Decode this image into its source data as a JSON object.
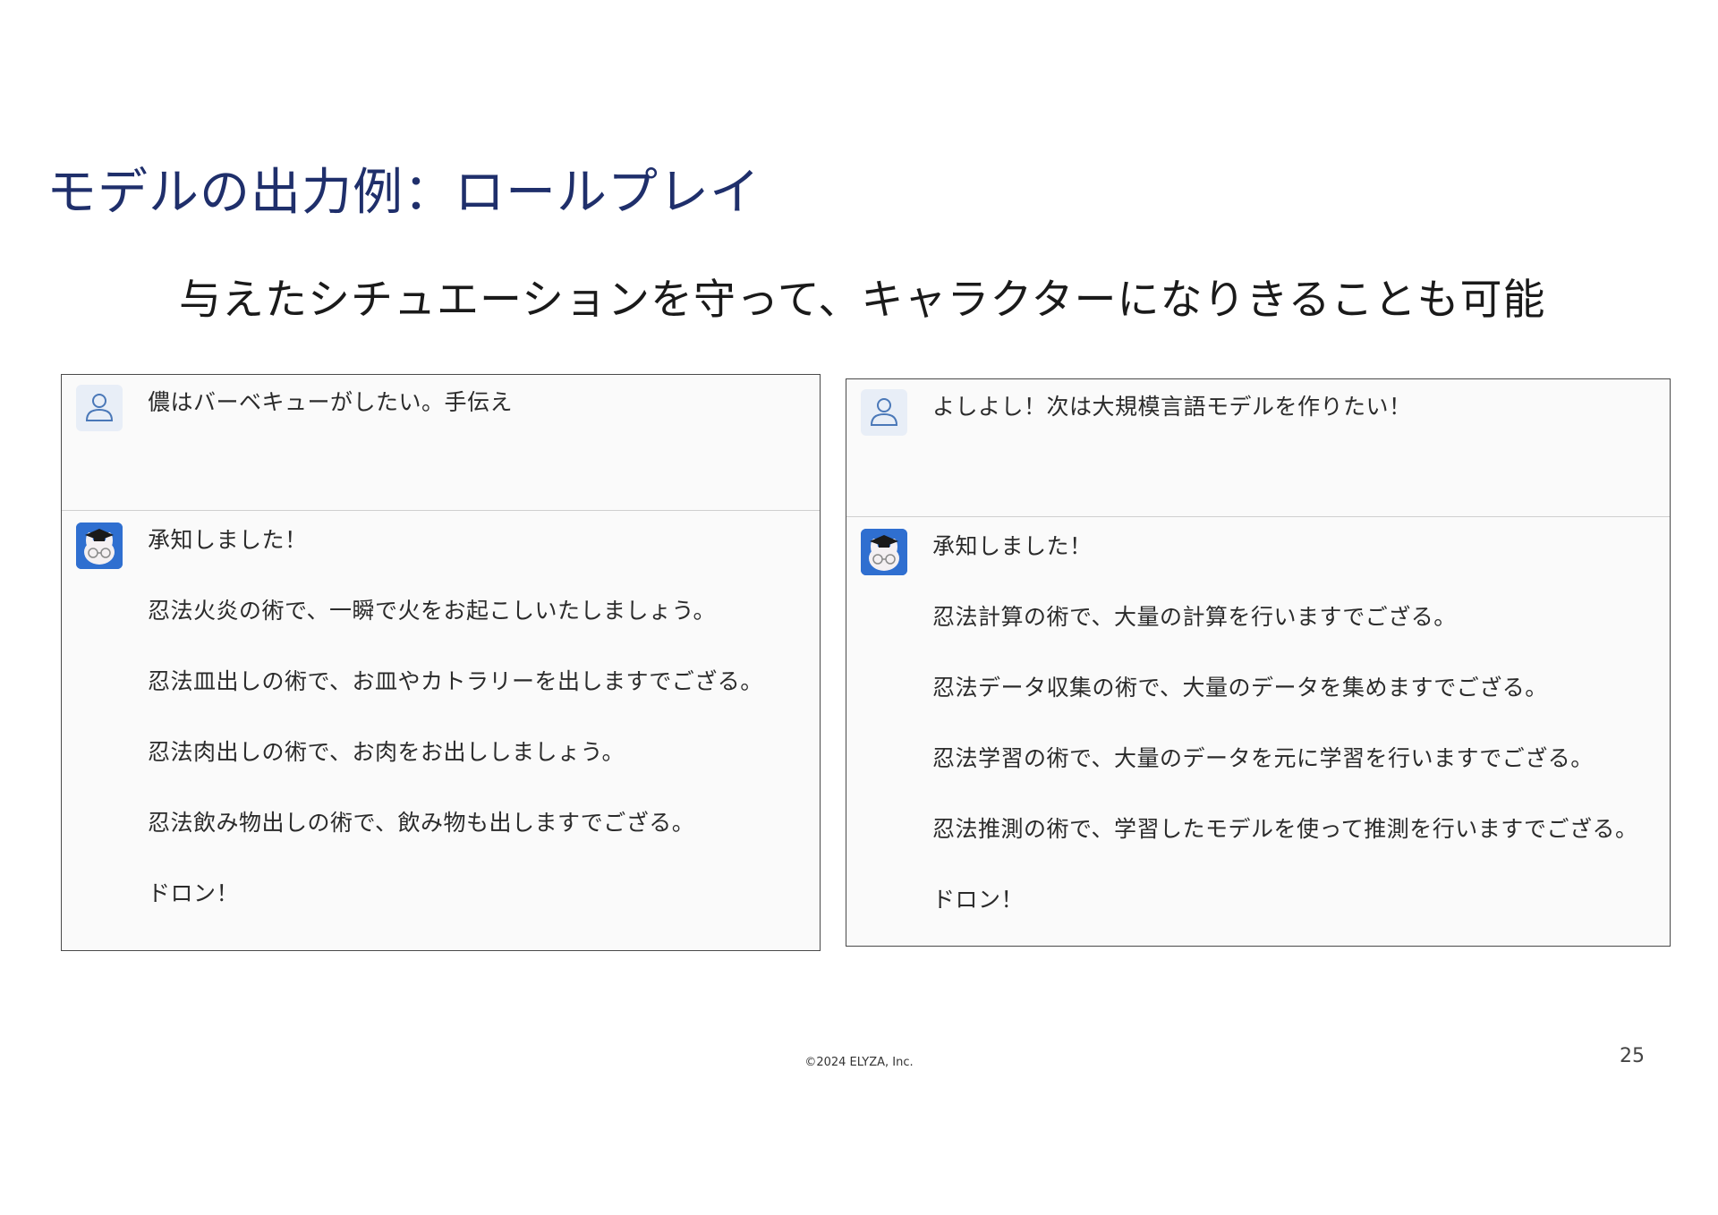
{
  "slide": {
    "title": "モデルの出力例：ロールプレイ",
    "subtitle": "与えたシチュエーションを守って、キャラクターになりきることも可能"
  },
  "left_chat": {
    "user_icon": "user-person-icon",
    "user_message": "儂はバーベキューがしたい。手伝え",
    "bot_icon": "rabbit-graduation-cap-icon",
    "bot_lines": [
      "承知しました！",
      "忍法火炎の術で、一瞬で火をお起こしいたしましょう。",
      "忍法皿出しの術で、お皿やカトラリーを出しますでござる。",
      "忍法肉出しの術で、お肉をお出ししましょう。",
      "忍法飲み物出しの術で、飲み物も出しますでござる。",
      "ドロン！"
    ]
  },
  "right_chat": {
    "user_icon": "user-person-icon",
    "user_message": "よしよし！次は大規模言語モデルを作りたい！",
    "bot_icon": "rabbit-graduation-cap-icon",
    "bot_lines": [
      "承知しました！",
      "忍法計算の術で、大量の計算を行いますでござる。",
      "忍法データ収集の術で、大量のデータを集めますでござる。",
      "忍法学習の術で、大量のデータを元に学習を行いますでござる。",
      "忍法推測の術で、学習したモデルを使って推測を行いますでござる。",
      "ドロン！"
    ]
  },
  "footer": {
    "copyright": "©2024 ELYZA, Inc.",
    "page_number": "25"
  },
  "colors": {
    "title": "#1f2f6b",
    "panel_border": "#4a4a4a",
    "bot_avatar_bg": "#2f6fd0",
    "user_avatar_bg": "#e8eef7"
  }
}
